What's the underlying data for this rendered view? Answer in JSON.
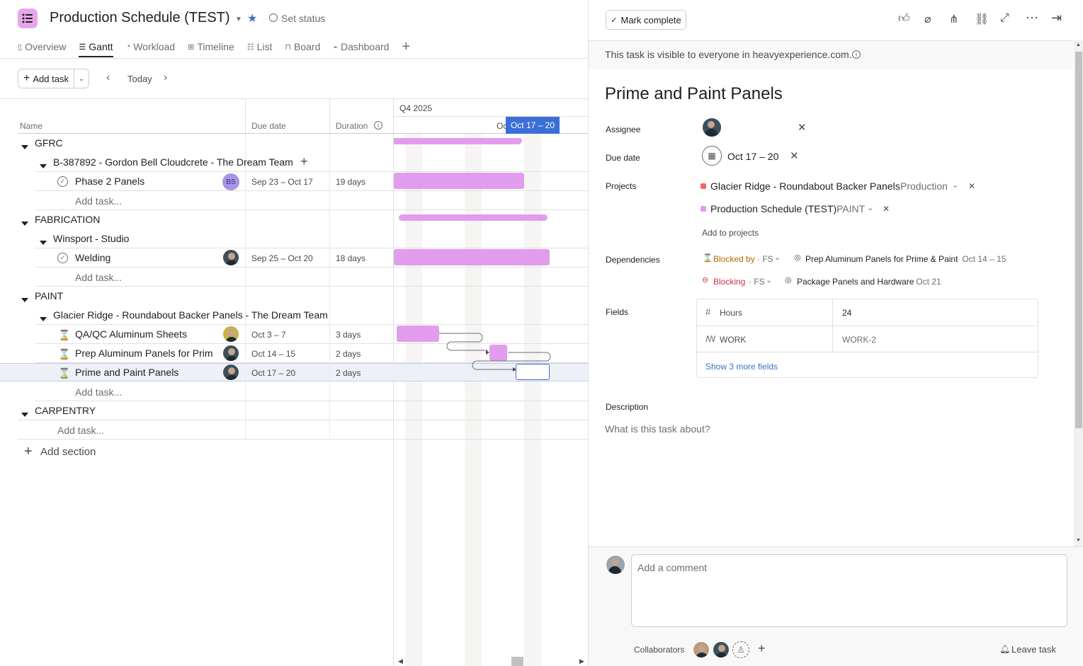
{
  "header": {
    "title": "Production Schedule (TEST)",
    "set_status": "Set status"
  },
  "tabs": [
    {
      "label": "Overview"
    },
    {
      "label": "Gantt"
    },
    {
      "label": "Workload"
    },
    {
      "label": "Timeline"
    },
    {
      "label": "List"
    },
    {
      "label": "Board"
    },
    {
      "label": "Dashboard"
    }
  ],
  "toolbar": {
    "add_task": "Add task",
    "today": "Today"
  },
  "columns": {
    "name": "Name",
    "due": "Due date",
    "duration": "Duration"
  },
  "timeline": {
    "quarter": "Q4 2025",
    "partial": "Oc",
    "highlight": "Oct 17 – 20"
  },
  "sections": [
    {
      "name": "GFRC"
    },
    {
      "name": "FABRICATION"
    },
    {
      "name": "PAINT"
    },
    {
      "name": "CARPENTRY"
    }
  ],
  "groups": [
    {
      "name": "B-387892 - Gordon Bell Cloudcrete - The Dream Team"
    },
    {
      "name": "Winsport - Studio"
    },
    {
      "name": "Glacier Ridge - Roundabout Backer Panels - The Dream Team"
    }
  ],
  "tasks": [
    {
      "name": "Phase 2 Panels",
      "due": "Sep 23 – Oct 17",
      "duration": "19 days",
      "assignee": "BS"
    },
    {
      "name": "Welding",
      "due": "Sep 25 – Oct 20",
      "duration": "18 days"
    },
    {
      "name": "QA/QC Aluminum Sheets",
      "due": "Oct 3 – 7",
      "duration": "3 days"
    },
    {
      "name": "Prep Aluminum Panels for Prime",
      "due": "Oct 14 – 15",
      "duration": "2 days"
    },
    {
      "name": "Prime and Paint Panels",
      "due": "Oct 17 – 20",
      "duration": "2 days"
    }
  ],
  "add_task_row": "Add task...",
  "add_section": "Add section",
  "detail": {
    "mark_complete": "Mark complete",
    "visibility": "This task is visible to everyone in heavyexperience.com.",
    "title": "Prime and Paint Panels",
    "assignee_label": "Assignee",
    "due_label": "Due date",
    "due_value": "Oct 17 – 20",
    "projects_label": "Projects",
    "projects": [
      {
        "name": "Glacier Ridge - Roundabout Backer Panels",
        "section": "Production",
        "color": "#f06a6a"
      },
      {
        "name": "Production Schedule (TEST)",
        "section": "PAINT",
        "color": "#e29cee"
      }
    ],
    "add_to_projects": "Add to projects",
    "dependencies_label": "Dependencies",
    "blocked_by": "Blocked by",
    "blocked_by_type": "· FS",
    "blocked_task": "Prep Aluminum Panels for Prime & Paint",
    "blocked_date": "· Oct 14 – 15",
    "blocking": "Blocking",
    "blocking_type": "· FS",
    "blocking_task": "Package Panels and Hardware",
    "blocking_date": "· Oct 21",
    "fields_label": "Fields",
    "fields": [
      {
        "name": "Hours",
        "value": "24"
      },
      {
        "name": "WORK",
        "value": "WORK-2"
      }
    ],
    "show_more": "Show 3 more fields",
    "description_label": "Description",
    "description_placeholder": "What is this task about?",
    "comment_placeholder": "Add a comment",
    "collaborators": "Collaborators",
    "leave_task": "Leave task"
  },
  "colors": {
    "accent": "#e29cee",
    "highlight": "#3a6fd8",
    "link": "#3d6fc4",
    "blocked": "#b26a00",
    "blocking": "#c8344a"
  }
}
